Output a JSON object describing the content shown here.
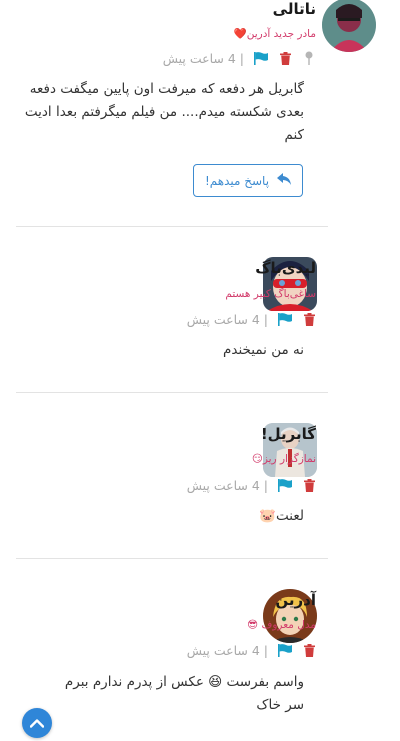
{
  "comments": [
    {
      "name": "ناتالی",
      "rank": "مادر جدید آدرین❤️",
      "time": "| 4 ساعت پیش",
      "body": "گابریل هر دفعه که میرفت اون پایین میگفت دفعه بعدی شکسته میدم.... من فیلم میگرفتم بعدا ادیت کنم",
      "reply_label": "پاسخ میدهم!"
    },
    {
      "name": "لیدی‌باگ",
      "rank": "ساغی‌باگ کبیر هستم",
      "time": "| 4 ساعت پیش",
      "body": "نه من نمیخندم"
    },
    {
      "name": "گابریل!",
      "rank": "نمازگزار ریز😏",
      "time": "| 4 ساعت پیش",
      "body": "لعنت🐷"
    },
    {
      "name": "آدرین",
      "rank": "مدل معروف 😎",
      "time": "| 4 ساعت پیش",
      "body": "واسم بفرست 😆 عکس از پدرم ندارم ببرم سر خاک"
    }
  ],
  "colors": {
    "accent": "#3d8bd0",
    "rank": "#d23a6a",
    "flag": "#1aa1c9",
    "trash": "#d03c3c"
  },
  "icons": {
    "pin": "pin-icon",
    "flag": "flag-icon",
    "trash": "trash-icon",
    "reply": "reply-arrow-icon",
    "scroll": "chevron-up-icon"
  }
}
